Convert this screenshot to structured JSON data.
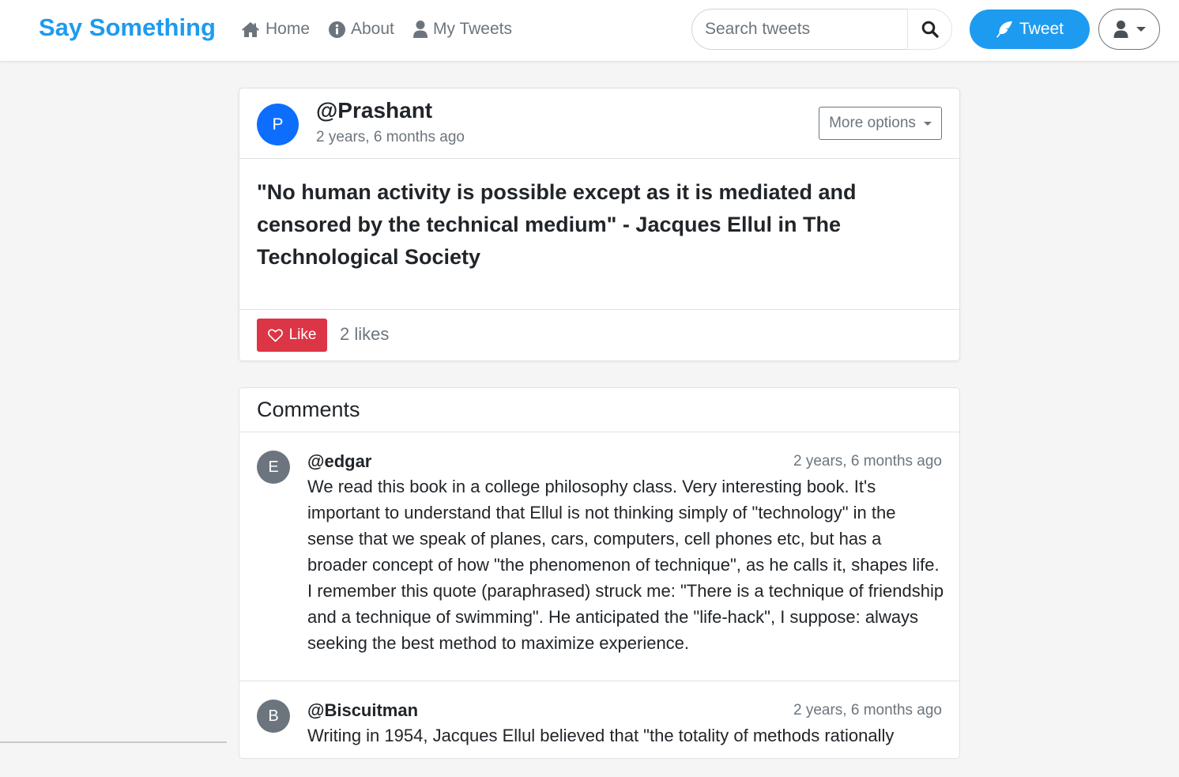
{
  "navbar": {
    "brand": "Say Something",
    "links": [
      {
        "label": "Home",
        "icon": "home-icon"
      },
      {
        "label": "About",
        "icon": "info-icon"
      },
      {
        "label": "My Tweets",
        "icon": "user-icon"
      }
    ],
    "search_placeholder": "Search tweets",
    "tweet_button": "Tweet"
  },
  "tweet": {
    "author_initial": "P",
    "author": "@Prashant",
    "time": "2 years, 6 months ago",
    "more_options": "More options",
    "body": "\"No human activity is possible except as it is mediated and censored by the technical medium\" - Jacques Ellul in The Technological Society",
    "like_label": "Like",
    "likes": "2 likes"
  },
  "comments": {
    "title": "Comments",
    "items": [
      {
        "initial": "E",
        "author": "@edgar",
        "time": "2 years, 6 months ago",
        "text": "We read this book in a college philosophy class. Very interesting book. It's important to understand that Ellul is not thinking simply of \"technology\" in the sense that we speak of planes, cars, computers, cell phones etc, but has a broader concept of how \"the phenomenon of technique\", as he calls it, shapes life. I remember this quote (paraphrased) struck me: \"There is a technique of friendship and a technique of swimming\". He anticipated the \"life-hack\", I suppose: always seeking the best method to maximize experience."
      },
      {
        "initial": "B",
        "author": "@Biscuitman",
        "time": "2 years, 6 months ago",
        "text": "Writing in 1954, Jacques Ellul believed that \"the totality of methods rationally"
      }
    ]
  },
  "colors": {
    "brand": "#1d9bf0",
    "author_avatar": "#0d6efd",
    "comment_avatar": "#6c757d",
    "like": "#dc3545"
  }
}
